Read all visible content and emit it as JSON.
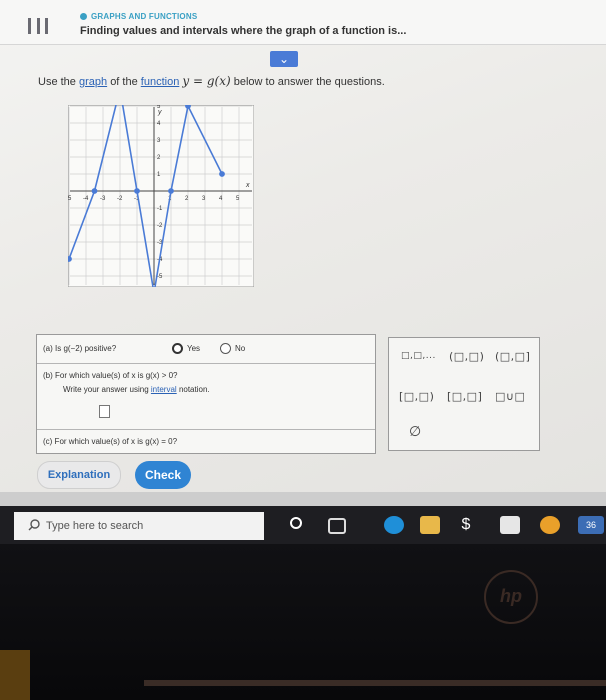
{
  "header": {
    "crumb": "GRAPHS AND FUNCTIONS",
    "title": "Finding values and intervals where the graph of a function is..."
  },
  "question": {
    "prefix": "Use the",
    "link_graph": "graph",
    "of_the": "of the",
    "link_function": "function",
    "math": "y = g(x)",
    "suffix": "below to answer the questions."
  },
  "graph": {
    "axis_x_label": "x",
    "axis_y_label": "y",
    "x_ticks": [
      "-5",
      "-4",
      "-3",
      "-2",
      "-1",
      "1",
      "2",
      "3",
      "4",
      "5"
    ],
    "y_ticks": [
      "5",
      "4",
      "3",
      "2",
      "1",
      "-1",
      "-2",
      "-3",
      "-4",
      "-5"
    ],
    "points": [
      {
        "x": -5,
        "y": -4
      },
      {
        "x": -3.5,
        "y": 0
      },
      {
        "x": -2,
        "y": 6
      },
      {
        "x": -1,
        "y": 0
      },
      {
        "x": 0,
        "y": -6
      },
      {
        "x": 1,
        "y": 0
      },
      {
        "x": 2,
        "y": 5
      },
      {
        "x": 4,
        "y": 1
      }
    ],
    "open_points": [
      {
        "x": 0,
        "y": -6
      }
    ],
    "curve_color": "#4a7bd6"
  },
  "part_a": {
    "label": "(a) Is g(−2) positive?",
    "yes": "Yes",
    "no": "No"
  },
  "part_b": {
    "label": "(b) For which value(s) of x is g(x) > 0?",
    "hint_prefix": "Write your answer using",
    "hint_link": "interval",
    "hint_suffix": "notation."
  },
  "part_c": {
    "label": "(c) For which value(s) of x is g(x) = 0?"
  },
  "palette": {
    "b1": "□,□,...",
    "b2": "(□,□)",
    "b3": "(□,□]",
    "b4": "[□,□)",
    "b5": "[□,□]",
    "b6": "□∪□",
    "b7": "∅"
  },
  "buttons": {
    "explanation": "Explanation",
    "check": "Check"
  },
  "taskbar": {
    "search": "Type here to search",
    "badge": "36"
  },
  "brand": "hp"
}
